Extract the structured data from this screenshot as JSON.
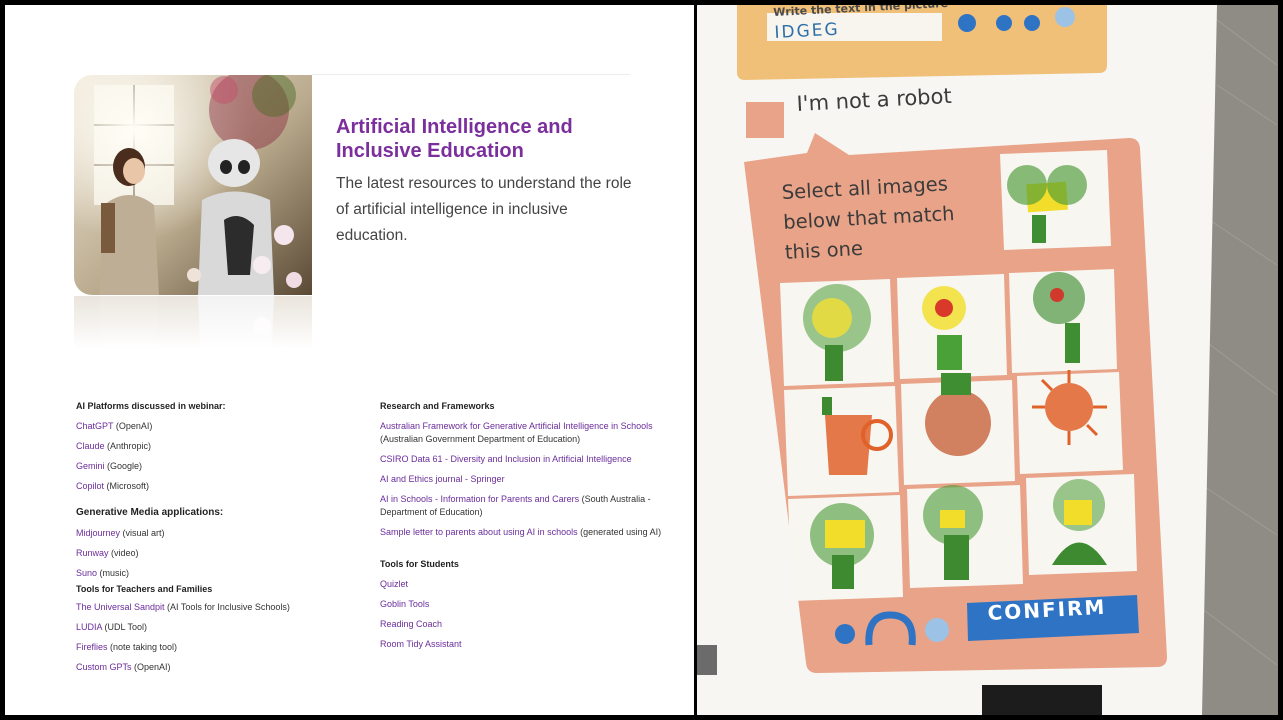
{
  "hero": {
    "title": "Artificial Intelligence and Inclusive Education",
    "description": "The latest resources to understand the role of artificial intelligence in inclusive education."
  },
  "columns": {
    "left": {
      "heading_platforms": "AI Platforms discussed in webinar:",
      "platforms": [
        {
          "link": "ChatGPT",
          "note": " (OpenAI)"
        },
        {
          "link": "Claude",
          "note": " (Anthropic)"
        },
        {
          "link": "Gemini",
          "note": " (Google)"
        },
        {
          "link": "Copilot",
          "note": " (Microsoft)"
        }
      ],
      "heading_media": "Generative Media applications:",
      "media": [
        {
          "link": "Midjourney",
          "note": " (visual art)"
        },
        {
          "link": "Runway",
          "note": " (video)"
        },
        {
          "link": "Suno",
          "note": " (music)"
        }
      ],
      "heading_teachers": "Tools for Teachers and Families",
      "teachers": [
        {
          "link": "The Universal Sandpit",
          "note": " (AI Tools for Inclusive Schools)"
        },
        {
          "link": "LUDIA",
          "note": " (UDL Tool)"
        },
        {
          "link": "Fireflies",
          "note": " (note taking tool)"
        },
        {
          "link": "Custom GPTs",
          "note": " (OpenAI)"
        }
      ]
    },
    "right": {
      "heading_research": "Research and Frameworks",
      "research": [
        {
          "link": "Australian Framework for Generative Artificial Intelligence in Schools",
          "note": " (Australian Government Department of Education)"
        },
        {
          "link": "CSIRO Data 61 - Diversity and Inclusion in Artificial Intelligence",
          "note": ""
        },
        {
          "link": "AI and Ethics journal - Springer",
          "note": ""
        },
        {
          "link": "AI in Schools - Information for Parents and Carers",
          "note": " (South Australia - Department of Education)"
        },
        {
          "link": "Sample letter to parents about using AI in schools",
          "note": " (generated using AI)"
        }
      ],
      "heading_students": "Tools for Students",
      "students": [
        {
          "link": "Quizlet",
          "note": ""
        },
        {
          "link": "Goblin Tools",
          "note": ""
        },
        {
          "link": "Reading Coach",
          "note": ""
        },
        {
          "link": "Room Tidy Assistant",
          "note": ""
        }
      ]
    }
  },
  "photo": {
    "write_prompt": "Write the text in the picture",
    "captcha_code": "IDGEG",
    "not_robot": "I'm not a robot",
    "select_instruction": "Select all images below that match this one",
    "confirm": "CONFIRM"
  },
  "colors": {
    "purple": "#7a2f9c",
    "card_salmon": "#e8a388",
    "confirm_blue": "#2f74c4"
  }
}
